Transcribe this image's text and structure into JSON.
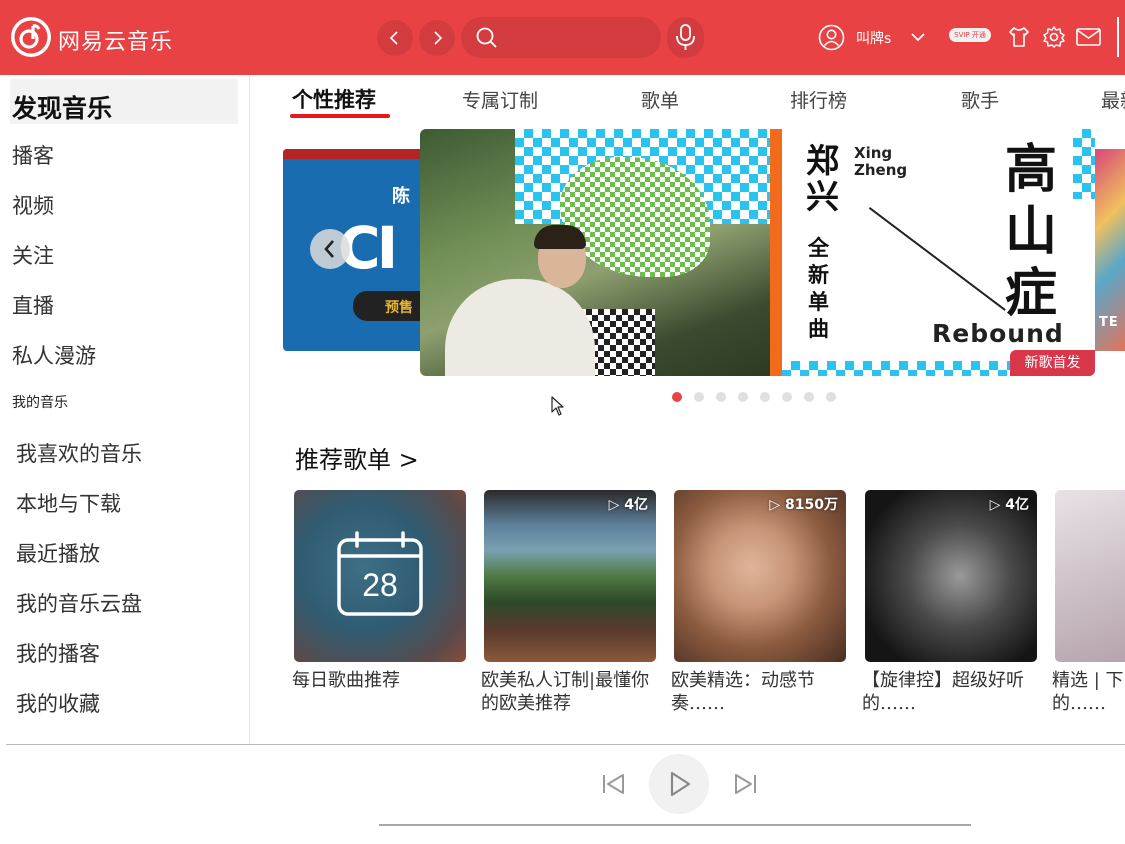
{
  "app": {
    "name": "网易云音乐",
    "username": "叫牌s",
    "vip_label": "SVIP 开通"
  },
  "topbar": {
    "back_icon": "chevron-left-icon",
    "forward_icon": "chevron-right-icon",
    "search_placeholder": "",
    "icons": [
      "search-icon",
      "microphone-icon",
      "user-icon",
      "chevron-down-icon",
      "tshirt-icon",
      "gear-icon",
      "mail-icon"
    ]
  },
  "sidebar": {
    "active": "发现音乐",
    "items": [
      "播客",
      "视频",
      "关注",
      "直播",
      "私人漫游"
    ],
    "section_title": "我的音乐",
    "my_music": [
      "我喜欢的音乐",
      "本地与下载",
      "最近播放",
      "我的音乐云盘",
      "我的播客",
      "我的收藏"
    ]
  },
  "tabs": [
    "个性推荐",
    "专属订制",
    "歌单",
    "排行榜",
    "歌手",
    "最新音乐"
  ],
  "banner": {
    "left_text_1": "陈",
    "left_text_2": "CI",
    "left_tag": "预售",
    "artist_name": "郑兴",
    "artist_pinyin_1": "Xing",
    "artist_pinyin_2": "Zheng",
    "subtitle": "全新单曲",
    "title": "高山症",
    "title_en": "Rebound",
    "tag": "新歌首发",
    "right_text": "TE",
    "dots_total": 8,
    "active_dot": 0
  },
  "recommend": {
    "title": "推荐歌单 >",
    "calendar_day": "28",
    "cards": [
      {
        "caption": "每日歌曲推荐",
        "play_count": ""
      },
      {
        "caption": "欧美私人订制|最懂你的欧美推荐",
        "play_count": "▷ 4亿"
      },
      {
        "caption": "欧美精选：动感节奏……",
        "play_count": "▷ 8150万"
      },
      {
        "caption": "【旋律控】超级好听的……",
        "play_count": "▷ 4亿"
      },
      {
        "caption": "精选 | 下 的……",
        "play_count": ""
      }
    ]
  },
  "player": {
    "icons": [
      "previous-icon",
      "play-icon",
      "next-icon"
    ]
  },
  "colors": {
    "brand": "#e84245",
    "tab_underline": "#e21a1a",
    "banner_tag": "#d8374a"
  }
}
